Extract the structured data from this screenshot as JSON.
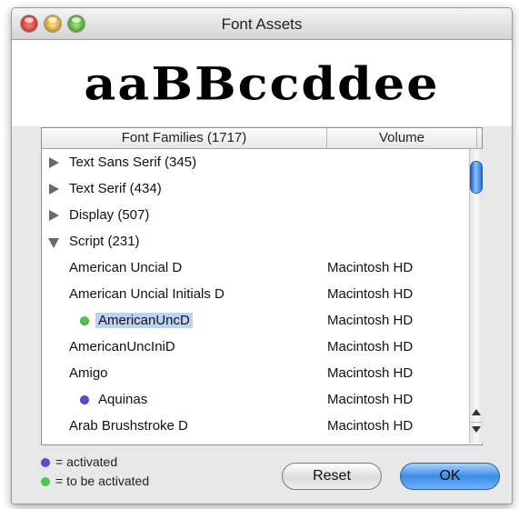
{
  "window": {
    "title": "Font Assets"
  },
  "preview": {
    "text": "aaBBccddee"
  },
  "table": {
    "columns": [
      "Font Families (1717)",
      "Volume"
    ],
    "rows": [
      {
        "label": "Text Sans Serif (345)",
        "volume": "",
        "kind": "group",
        "expanded": false
      },
      {
        "label": "Text Serif (434)",
        "volume": "",
        "kind": "group",
        "expanded": false
      },
      {
        "label": "Display (507)",
        "volume": "",
        "kind": "group",
        "expanded": false
      },
      {
        "label": "Script (231)",
        "volume": "",
        "kind": "group",
        "expanded": true
      },
      {
        "label": "American Uncial D",
        "volume": "Macintosh HD",
        "kind": "font",
        "status": ""
      },
      {
        "label": "American Uncial Initials D",
        "volume": "Macintosh HD",
        "kind": "font",
        "status": ""
      },
      {
        "label": "AmericanUncD",
        "volume": "Macintosh HD",
        "kind": "font",
        "status": "to-be-activated",
        "selected": true
      },
      {
        "label": "AmericanUncIniD",
        "volume": "Macintosh HD",
        "kind": "font",
        "status": ""
      },
      {
        "label": "Amigo",
        "volume": "Macintosh HD",
        "kind": "font",
        "status": ""
      },
      {
        "label": "Aquinas",
        "volume": "Macintosh HD",
        "kind": "font",
        "status": "activated"
      },
      {
        "label": "Arab Brushstroke D",
        "volume": "Macintosh HD",
        "kind": "font",
        "status": ""
      }
    ]
  },
  "legend": {
    "activated": "= activated",
    "to_be_activated": "= to be activated"
  },
  "buttons": {
    "reset": "Reset",
    "ok": "OK"
  },
  "colors": {
    "activated": "#5a4bd1",
    "to_be_activated": "#4fc64f",
    "selection": "#bcd3f4",
    "default_button": "#3d8ce6"
  }
}
